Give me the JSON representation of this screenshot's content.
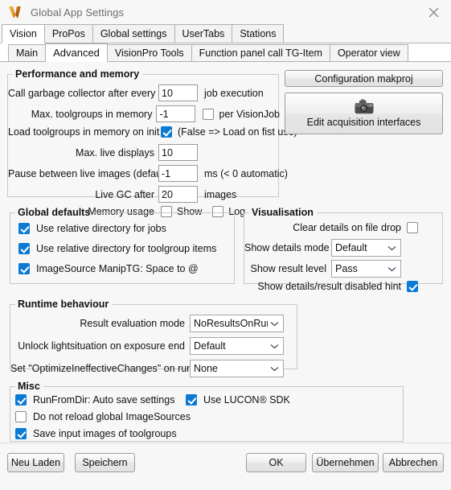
{
  "window": {
    "title": "Global App Settings",
    "icon": "app-logo-v-icon",
    "close_label": "✕",
    "accent_blue": "#0a7ad4",
    "logo_orange": "#e8991f"
  },
  "tabs_primary": [
    {
      "label": "Vision",
      "active": true
    },
    {
      "label": "ProPos",
      "active": false
    },
    {
      "label": "Global settings",
      "active": false
    },
    {
      "label": "UserTabs",
      "active": false
    },
    {
      "label": "Stations",
      "active": false
    }
  ],
  "tabs_secondary": [
    {
      "label": "Main",
      "active": false
    },
    {
      "label": "Advanced",
      "active": true
    },
    {
      "label": "VisionPro Tools",
      "active": false
    },
    {
      "label": "Function panel call TG-Item",
      "active": false
    },
    {
      "label": "Operator view",
      "active": false
    }
  ],
  "performance": {
    "legend": "Performance and memory",
    "gc_label": "Call garbage collector after every",
    "gc_value": "10",
    "gc_suffix": "job execution",
    "max_toolgroups_label": "Max. toolgroups in memory",
    "max_toolgroups_value": "-1",
    "per_visionjob_label": "per VisionJob",
    "per_visionjob_checked": false,
    "load_toolgroups_label": "Load toolgroups in memory on init",
    "load_toolgroups_checked": true,
    "load_toolgroups_hint": "(False => Load on fist use)",
    "max_live_label": "Max. live displays",
    "max_live_value": "10",
    "pause_label": "Pause between live images (default)",
    "pause_value": "-1",
    "pause_suffix": "ms (< 0 automatic)",
    "live_gc_label": "Live GC after",
    "live_gc_value": "20",
    "live_gc_suffix": "images",
    "memory_usage_label": "Memory usage",
    "memory_show_label": "Show",
    "memory_show_checked": false,
    "memory_log_label": "Log",
    "memory_log_checked": false
  },
  "side_buttons": {
    "configuration_makproj": "Configuration makproj",
    "edit_acquisition": "Edit acquisition interfaces",
    "edit_acquisition_icon": "camera-icon"
  },
  "global_defaults": {
    "legend": "Global defaults",
    "items": [
      {
        "label": "Use relative directory for jobs",
        "checked": true
      },
      {
        "label": "Use relative directory for toolgroup items",
        "checked": true
      },
      {
        "label": "ImageSource ManipTG: Space to @",
        "checked": true
      }
    ]
  },
  "visualisation": {
    "legend": "Visualisation",
    "clear_details_label": "Clear details on file drop",
    "clear_details_checked": false,
    "show_details_mode_label": "Show details mode",
    "show_details_mode_value": "Default",
    "show_result_level_label": "Show result level",
    "show_result_level_value": "Pass",
    "show_hint_label": "Show details/result disabled hint",
    "show_hint_checked": true
  },
  "runtime": {
    "legend": "Runtime behaviour",
    "result_eval_label": "Result evaluation mode",
    "result_eval_value": "NoResultsOnRunEn",
    "unlock_label": "Unlock lightsituation on exposure end",
    "unlock_value": "Default",
    "optimize_label": "Set \"OptimizeIneffectiveChanges\" on run",
    "optimize_value": "None"
  },
  "misc": {
    "legend": "Misc",
    "runfromdir_label": "RunFromDir: Auto save settings",
    "runfromdir_checked": true,
    "lucon_label": "Use LUCON® SDK",
    "lucon_checked": true,
    "no_reload_label": "Do not reload global ImageSources",
    "no_reload_checked": false,
    "save_input_label": "Save input images of toolgroups",
    "save_input_checked": true
  },
  "footer": {
    "neu_laden": "Neu Laden",
    "speichern": "Speichern",
    "ok": "OK",
    "uebernehmen": "Übernehmen",
    "abbrechen": "Abbrechen"
  }
}
